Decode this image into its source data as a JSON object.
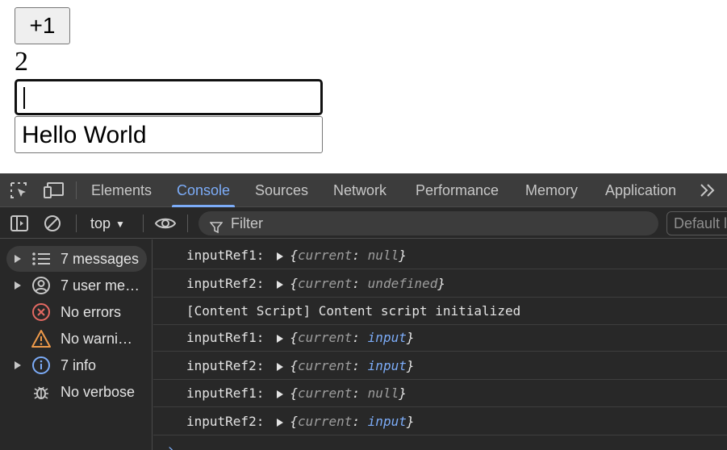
{
  "app": {
    "increment_label": "+1",
    "count": "2",
    "input1_value": "",
    "input2_value": "Hello World"
  },
  "devtools": {
    "tabs": [
      {
        "label": "Elements",
        "active": false
      },
      {
        "label": "Console",
        "active": true
      },
      {
        "label": "Sources",
        "active": false
      },
      {
        "label": "Network",
        "active": false
      },
      {
        "label": "Performance",
        "active": false
      },
      {
        "label": "Memory",
        "active": false
      },
      {
        "label": "Application",
        "active": false
      }
    ],
    "more_tabs_icon": "chevron-double-right-icon",
    "toolbar": {
      "context": "top",
      "filter_placeholder": "Filter",
      "levels": "Default levels"
    },
    "sidebar": [
      {
        "label": "7 messages",
        "icon": "list-icon",
        "expandable": true,
        "selected": true
      },
      {
        "label": "7 user me…",
        "icon": "user-icon",
        "expandable": true,
        "selected": false
      },
      {
        "label": "No errors",
        "icon": "error-icon",
        "expandable": false,
        "selected": false
      },
      {
        "label": "No warni…",
        "icon": "warning-icon",
        "expandable": false,
        "selected": false
      },
      {
        "label": "7 info",
        "icon": "info-icon",
        "expandable": true,
        "selected": false
      },
      {
        "label": "No verbose",
        "icon": "bug-icon",
        "expandable": false,
        "selected": false
      }
    ],
    "messages": [
      {
        "prefix": "inputRef1:",
        "key": "current",
        "value": "null",
        "value_kind": "null"
      },
      {
        "prefix": "inputRef2:",
        "key": "current",
        "value": "undefined",
        "value_kind": "null"
      },
      {
        "text": "[Content Script] Content script initialized"
      },
      {
        "prefix": "inputRef1:",
        "key": "current",
        "value": "input",
        "value_kind": "node"
      },
      {
        "prefix": "inputRef2:",
        "key": "current",
        "value": "input",
        "value_kind": "node"
      },
      {
        "prefix": "inputRef1:",
        "key": "current",
        "value": "null",
        "value_kind": "null"
      },
      {
        "prefix": "inputRef2:",
        "key": "current",
        "value": "input",
        "value_kind": "node"
      }
    ],
    "colors": {
      "accent": "#7cacf8",
      "error": "#e46962",
      "warning": "#ee9a4a",
      "info": "#7cacf8"
    }
  }
}
